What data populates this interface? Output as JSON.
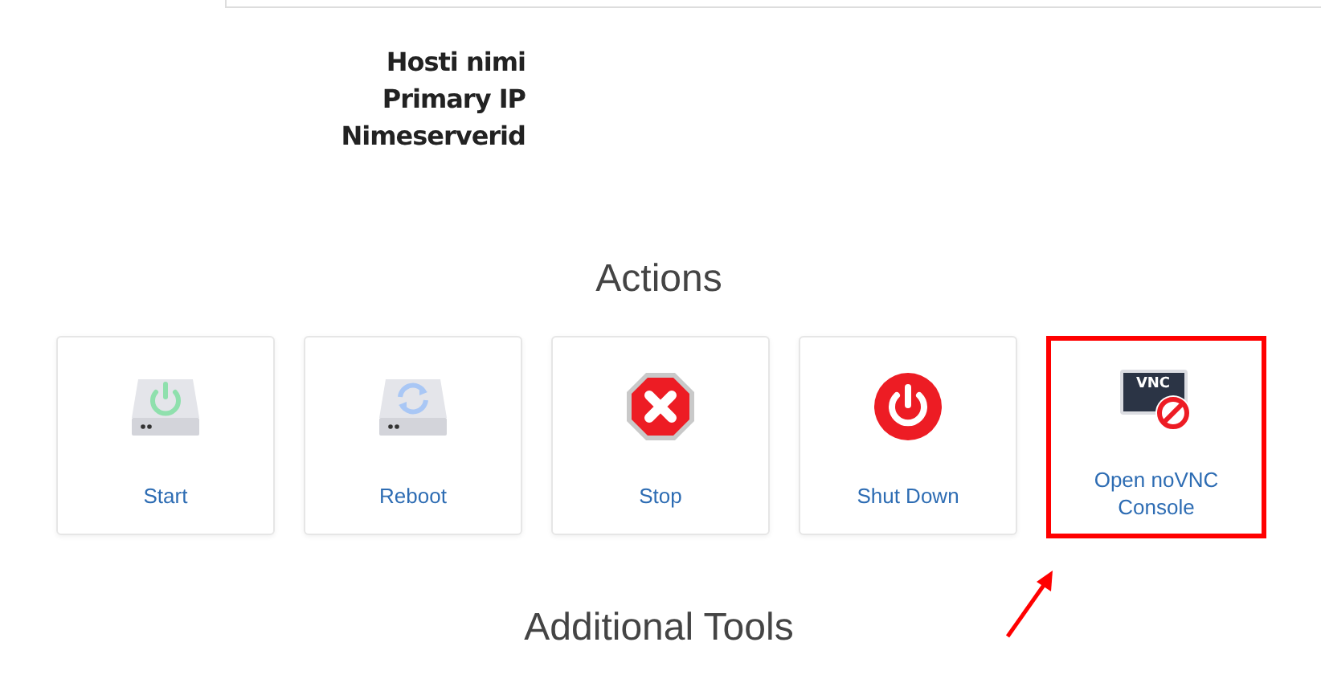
{
  "info_labels": [
    "Hosti nimi",
    "Primary IP",
    "Nimeserverid"
  ],
  "actions_title": "Actions",
  "actions": [
    {
      "kind": "start",
      "label": "Start",
      "highlighted": false
    },
    {
      "kind": "reboot",
      "label": "Reboot",
      "highlighted": false
    },
    {
      "kind": "stop",
      "label": "Stop",
      "highlighted": false
    },
    {
      "kind": "shutdown",
      "label": "Shut Down",
      "highlighted": false
    },
    {
      "kind": "vnc",
      "label": "Open noVNC Console",
      "icon_text": "VNC",
      "highlighted": true
    }
  ],
  "tools_title": "Additional Tools"
}
